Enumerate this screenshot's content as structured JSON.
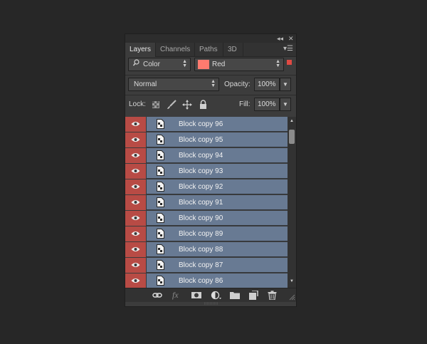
{
  "tabs": [
    {
      "label": "Layers",
      "active": true
    },
    {
      "label": "Channels",
      "active": false
    },
    {
      "label": "Paths",
      "active": false
    },
    {
      "label": "3D",
      "active": false
    }
  ],
  "titlebar": {
    "collapse": "◂◂",
    "close": "✕"
  },
  "filter": {
    "kind": "Color",
    "value": "Red",
    "swatch": "#ff7b6f",
    "indicator": "#e04a43"
  },
  "blend": {
    "mode": "Normal",
    "opacity_label": "Opacity:",
    "opacity": "100%"
  },
  "lock": {
    "label": "Lock:",
    "fill_label": "Fill:",
    "fill": "100%"
  },
  "layers": [
    {
      "name": "Block copy 96"
    },
    {
      "name": "Block copy 95"
    },
    {
      "name": "Block copy 94"
    },
    {
      "name": "Block copy 93"
    },
    {
      "name": "Block copy 92"
    },
    {
      "name": "Block copy 91"
    },
    {
      "name": "Block copy 90"
    },
    {
      "name": "Block copy 89"
    },
    {
      "name": "Block copy 88"
    },
    {
      "name": "Block copy 87"
    },
    {
      "name": "Block copy 86"
    }
  ],
  "footer_icons": [
    "link-icon",
    "fx-icon",
    "mask-icon",
    "adjustment-icon",
    "folder-icon",
    "new-layer-icon",
    "trash-icon"
  ],
  "colors": {
    "layer_bg": "#687a93",
    "visibility_bg": "#b84b45"
  }
}
